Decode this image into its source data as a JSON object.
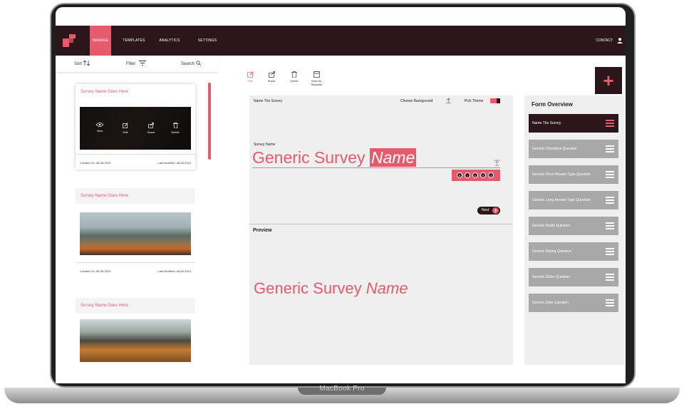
{
  "device": {
    "brand": "MacBook Pro"
  },
  "nav": {
    "items": [
      {
        "label": "MANAGE",
        "active": true
      },
      {
        "label": "TEMPLATES",
        "active": false
      },
      {
        "label": "ANALYTICS",
        "active": false
      },
      {
        "label": "SETTINGS",
        "active": false
      }
    ],
    "contact": "CONTACT",
    "user_icon": "user-icon",
    "logo_icon": "logo-icon"
  },
  "toolbar": {
    "sort": "Sort",
    "filter": "Filter",
    "search": "Search"
  },
  "cards": [
    {
      "title": "Survey Name Goes Here",
      "created": "Created On: 08-08-2019",
      "modified": "Last Modified: 08-08-2019",
      "actions": [
        "View",
        "Edit",
        "Share",
        "Delete"
      ]
    },
    {
      "title": "Survey Name Goes Here",
      "created": "Created On: 08-08-2019",
      "modified": "Last Modified: 08-08-2019"
    },
    {
      "title": "Survey Name Goes Here"
    }
  ],
  "editor": {
    "actions": [
      "Edit",
      "Share",
      "Delete",
      "Save As Template"
    ],
    "name_the_survey": "Name The Survey",
    "choose_background": "Choose Background",
    "pick_theme": "Pick Theme",
    "survey_name_label": "Survey Name",
    "title_plain": "Generic Survey",
    "title_highlight": "Name",
    "next": "Next",
    "preview_label": "Preview",
    "preview_plain": "Generic Survey",
    "preview_italic": "Name"
  },
  "overview": {
    "title": "Form Overview",
    "items": [
      {
        "label": "Name The Survey",
        "active": true
      },
      {
        "label": "Generic Checkbox Question",
        "active": false
      },
      {
        "label": "Generic Short Answer Type Question",
        "active": false
      },
      {
        "label": "Generic Long Answer Type Question",
        "active": false
      },
      {
        "label": "Generic Radio Question",
        "active": false
      },
      {
        "label": "Generic Rating Question",
        "active": false
      },
      {
        "label": "Generic Slider Question",
        "active": false
      },
      {
        "label": "Generic Date Question",
        "active": false
      }
    ]
  },
  "add_button": "+",
  "colors": {
    "accent": "#e75a6c",
    "dark": "#2a161b",
    "panel": "#efefef",
    "item": "#a8a8a8"
  }
}
